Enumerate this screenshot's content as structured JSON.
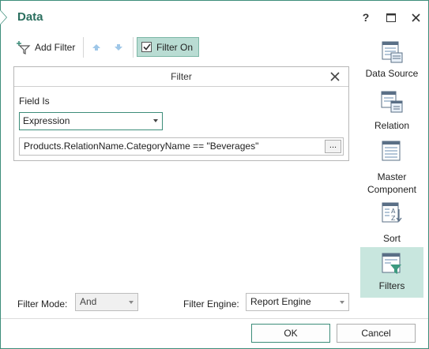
{
  "window": {
    "title": "Data",
    "help_label": "?"
  },
  "toolbar": {
    "add_filter_label": "Add Filter",
    "filter_on_label": "Filter On",
    "filter_on_checked": true
  },
  "filter_panel": {
    "header": "Filter",
    "field_is_label": "Field Is",
    "field_is_value": "Expression",
    "expression_value": "Products.RelationName.CategoryName == \"Beverages\"",
    "ellipsis_label": "..."
  },
  "sidebar": {
    "items": [
      {
        "label": "Data Source",
        "icon": "data-source-icon",
        "active": false
      },
      {
        "label": "Relation",
        "icon": "relation-icon",
        "active": false
      },
      {
        "label": "Master Component",
        "line1": "Master",
        "line2": "Component",
        "icon": "master-component-icon",
        "active": false
      },
      {
        "label": "Sort",
        "icon": "sort-icon",
        "active": false
      },
      {
        "label": "Filters",
        "icon": "filters-icon",
        "active": true
      }
    ]
  },
  "bottom": {
    "filter_mode_label": "Filter Mode:",
    "filter_mode_value": "And",
    "filter_engine_label": "Filter Engine:",
    "filter_engine_value": "Report Engine"
  },
  "buttons": {
    "ok_label": "OK",
    "cancel_label": "Cancel"
  },
  "colors": {
    "accent": "#3d8d7a",
    "active_bg": "#c8e6de",
    "filter_on_bg": "#b9dcd3",
    "title": "#2b6f5f"
  }
}
